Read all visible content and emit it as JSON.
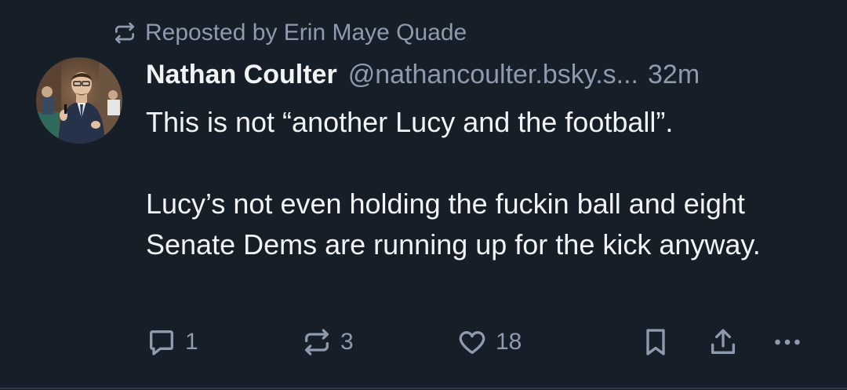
{
  "repost": {
    "label": "Reposted by Erin Maye Quade",
    "icon": "repost-icon"
  },
  "post": {
    "author_name": "Nathan Coulter",
    "author_handle": "@nathancoulter.bsky.s...",
    "timestamp": "32m",
    "paragraphs": [
      "This is not “another Lucy and the football”.",
      "Lucy’s not even holding the fuckin ball and eight Senate Dems are running up for the kick anyway."
    ]
  },
  "actions": {
    "reply_count": "1",
    "repost_count": "3",
    "like_count": "18",
    "icons": [
      "reply-icon",
      "repost-icon",
      "like-icon",
      "bookmark-icon",
      "share-icon",
      "more-icon"
    ]
  },
  "colors": {
    "background": "#161e27",
    "text": "#f1f3f5",
    "muted": "#8d9bad"
  }
}
